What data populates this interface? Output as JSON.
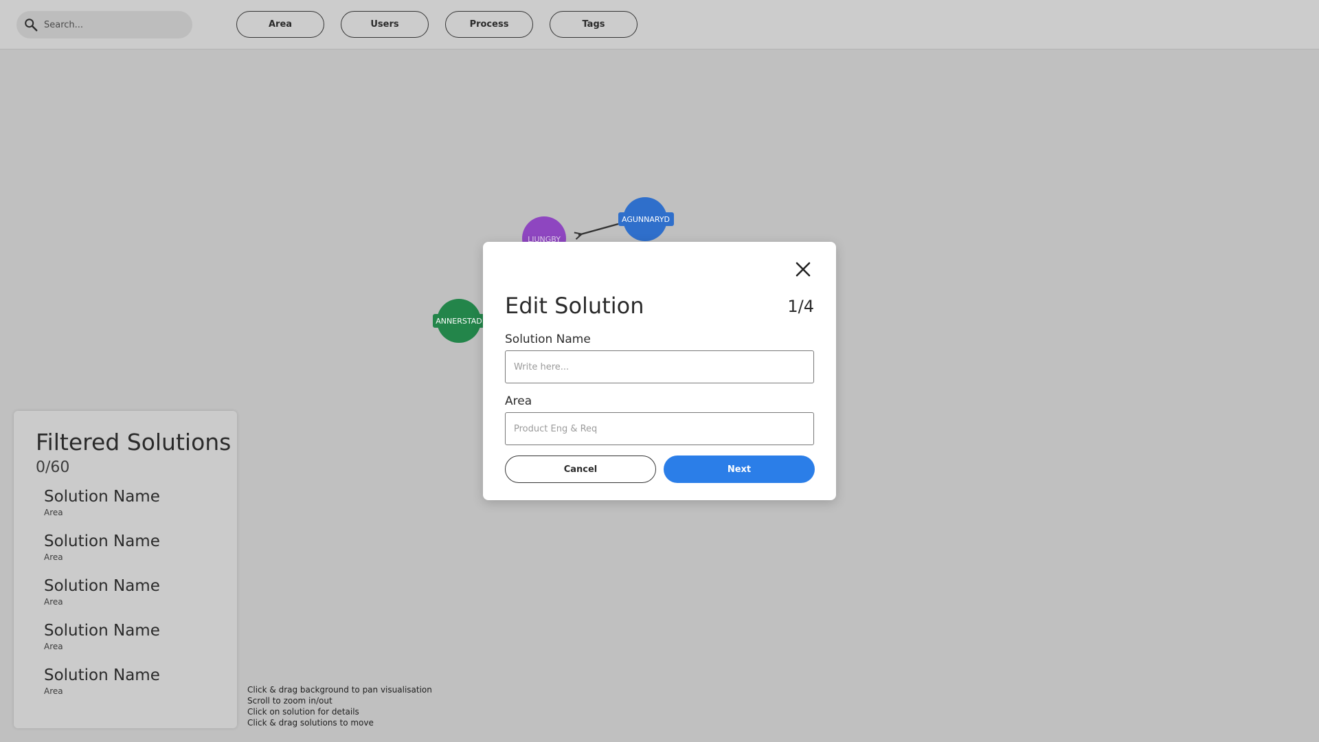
{
  "search": {
    "placeholder": "Search..."
  },
  "filters": [
    {
      "label": "Area"
    },
    {
      "label": "Users"
    },
    {
      "label": "Process"
    },
    {
      "label": "Tags"
    }
  ],
  "graph": {
    "nodes": [
      {
        "label": "AGUNNARYD",
        "color": "#2f6fcb"
      },
      {
        "label": "LJUNGBY",
        "color": "#8e46c0"
      },
      {
        "label": "ANNERSTAD",
        "color": "#23854a"
      }
    ]
  },
  "panel": {
    "title": "Filtered Solutions",
    "count": "0/60",
    "items": [
      {
        "name": "Solution Name",
        "area": "Area"
      },
      {
        "name": "Solution Name",
        "area": "Area"
      },
      {
        "name": "Solution Name",
        "area": "Area"
      },
      {
        "name": "Solution Name",
        "area": "Area"
      },
      {
        "name": "Solution Name",
        "area": "Area"
      }
    ]
  },
  "hints": [
    "Click & drag background to pan visualisation",
    "Scroll to zoom in/out",
    "Click on solution for details",
    "Click & drag solutions to move"
  ],
  "modal": {
    "title": "Edit Solution",
    "step": "1/4",
    "name_label": "Solution Name",
    "name_placeholder": "Write here...",
    "area_label": "Area",
    "area_placeholder": "Product Eng & Req",
    "cancel_label": "Cancel",
    "next_label": "Next"
  },
  "colors": {
    "accent": "#2b7ee8"
  },
  "icons": {
    "search": "search-icon",
    "close": "close-icon"
  }
}
